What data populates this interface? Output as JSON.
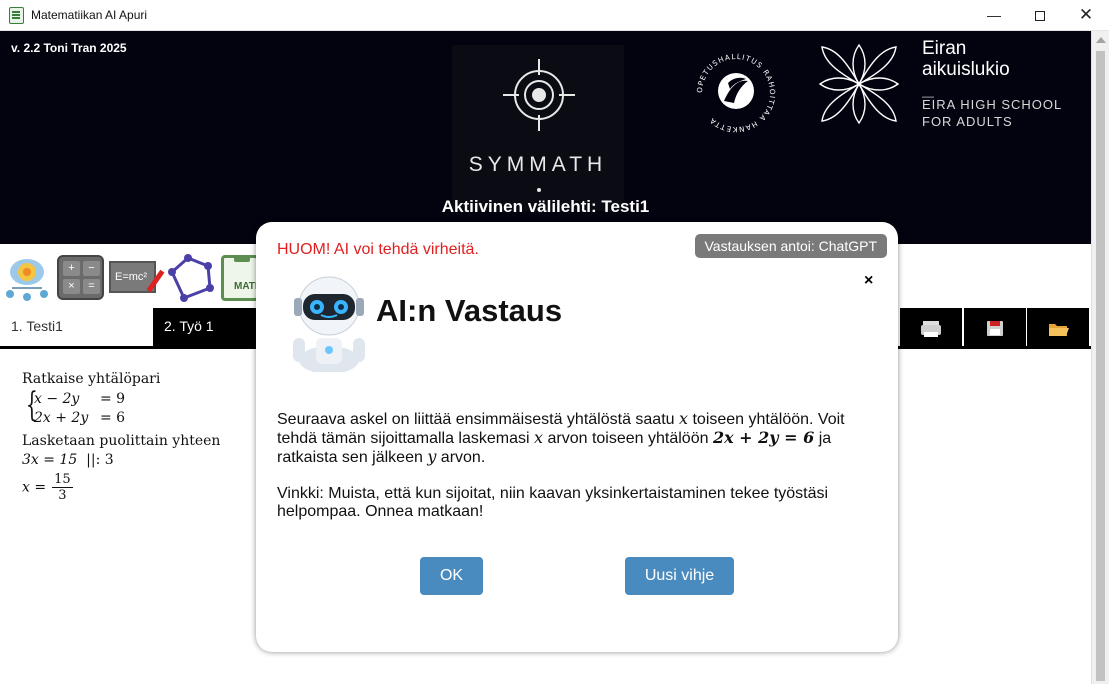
{
  "window": {
    "title": "Matematiikan AI Apuri",
    "minimize": "—",
    "close": "✕"
  },
  "header": {
    "version": "v. 2.2 Toni Tran 2025",
    "symmath_logo": "SYMMATH",
    "active_tab_label": "Aktiivinen välilehti: Testi1",
    "oph_seal_text": "OPETUSHALLITUS RAHOITTAA HANKETTA",
    "eira_name_line1": "Eiran",
    "eira_name_line2": "aikuislukio",
    "eira_dash": "—",
    "eira_en_line1": "EIRA HIGH SCHOOL",
    "eira_en_line2": "FOR ADULTS"
  },
  "toolbar": {
    "calc_keys": [
      "+",
      "−",
      "×",
      "="
    ],
    "formula_label": "E=mc²",
    "matik_label": "MATI"
  },
  "tabs": [
    {
      "label": "1. Testi1",
      "active": true
    },
    {
      "label": "2. Työ 1",
      "active": false
    }
  ],
  "tab_icons": [
    "printer-icon",
    "save-icon",
    "folder-icon"
  ],
  "worksheet": {
    "task": "Ratkaise yhtälöpari",
    "eq1_lhs": "x − 2y",
    "eq1_rhs": "= 9",
    "eq2_lhs": "2x + 2y",
    "eq2_rhs": "= 6",
    "step_text": "Lasketaan puolittain yhteen",
    "step_eq": "3x = 15",
    "step_op": "||: 3",
    "result_lhs": "x =",
    "result_num": "15",
    "result_den": "3"
  },
  "modal": {
    "warning": "HUOM! AI voi tehdä virheitä.",
    "source": "Vastauksen antoi: ChatGPT",
    "close": "×",
    "heading": "AI:n Vastaus",
    "para1_a": "Seuraava askel on liittää ensimmäisestä yhtälöstä saatu ",
    "para1_x1": "x",
    "para1_b": " toiseen yhtälöön. Voit tehdä tämän sijoittamalla laskemasi ",
    "para1_x2": "x",
    "para1_c": " arvon toiseen yhtälöön ",
    "para1_eq": "2x + 2y = 6",
    "para1_d": " ja ratkaista sen jälkeen ",
    "para1_y": "y",
    "para1_e": " arvon.",
    "para2": "Vinkki: Muista, että kun sijoitat, niin kaavan yksinkertaistaminen tekee työstäsi helpompaa. Onnea matkaan!",
    "ok_label": "OK",
    "hint_label": "Uusi vihje"
  },
  "colors": {
    "banner_bg": "#03030f",
    "accent_button": "#4a8bbf",
    "warning_red": "#e02020",
    "tab_active_underline": "#3b82c4"
  }
}
